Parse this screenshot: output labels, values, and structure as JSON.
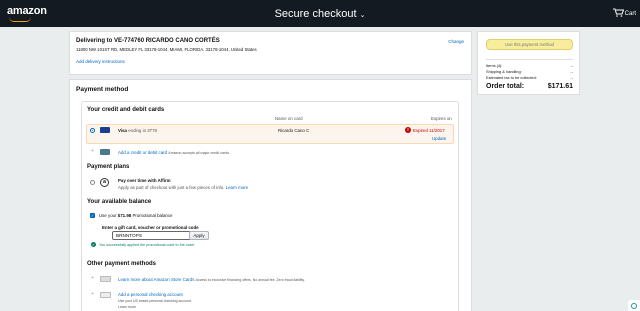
{
  "header": {
    "logo": "amazon",
    "title": "Secure checkout",
    "cart_label": "Cart"
  },
  "delivery": {
    "heading": "Delivering to VE-774760 RICARDO CANO CORTÉS",
    "address": "11800 NW 101ST RD, MEDLEY FL 33178-1044, MIAMI, FLORIDA, 33178-1044, United States",
    "instructions_link": "Add delivery instructions",
    "change_link": "Change"
  },
  "payment": {
    "title": "Payment method",
    "cards_section": {
      "title": "Your credit and debit cards",
      "col_name": "Name on card",
      "col_expires": "Expires on",
      "card": {
        "brand": "Visa",
        "ending": "ending in 3778",
        "name": "Ricardo Cano C",
        "status": "Expired 11/2017",
        "update_link": "Update"
      },
      "add_card_link": "Add a credit or debit card",
      "add_card_note": "Amazon accepts all major credit cards."
    },
    "plans_section": {
      "title": "Payment plans",
      "affirm_title": "Pay over time with Affirm",
      "affirm_desc": "Apply as part of checkout with just a few pieces of info.",
      "affirm_link": "Learn more"
    },
    "balance_section": {
      "title": "Your available balance",
      "use_balance_prefix": "Use your ",
      "use_balance_amount": "$71.98",
      "use_balance_suffix": " Promotional balance",
      "gift_label": "Enter a gift card, voucher or promotional code",
      "gift_value": "BRNNTOPS",
      "apply_label": "Apply",
      "success_msg": "You successfully applied the promotional code to the order."
    },
    "other_section": {
      "title": "Other payment methods",
      "store_card_link": "Learn more about Amazon Store Cards",
      "store_card_note": "Access to exclusive financing offers. No annual fee. Zero fraud liability.",
      "checking_link": "Add a personal checking account",
      "checking_note": "Use your US based personal checking account.",
      "checking_learn": "Learn more"
    }
  },
  "summary": {
    "use_button": "Use this payment method",
    "items_label": "Items (4):",
    "items_value": "--",
    "shipping_label": "Shipping & handling:",
    "shipping_value": "--",
    "tax_label": "Estimated tax to be collected:",
    "tax_value": "--",
    "total_label": "Order total:",
    "total_value": "$171.61"
  },
  "colors": {
    "header_bg": "#131a22",
    "link": "#0066c0",
    "error": "#c40000",
    "selected_row_bg": "#fcf5ee",
    "button_yellow": "#f7ed9c"
  },
  "icons": [
    "chevron-down-icon",
    "cart-icon",
    "visa-card-icon",
    "error-icon",
    "affirm-logo-icon",
    "checkbox-checked-icon",
    "success-check-icon",
    "store-card-icon",
    "bank-icon",
    "chat-icon"
  ]
}
